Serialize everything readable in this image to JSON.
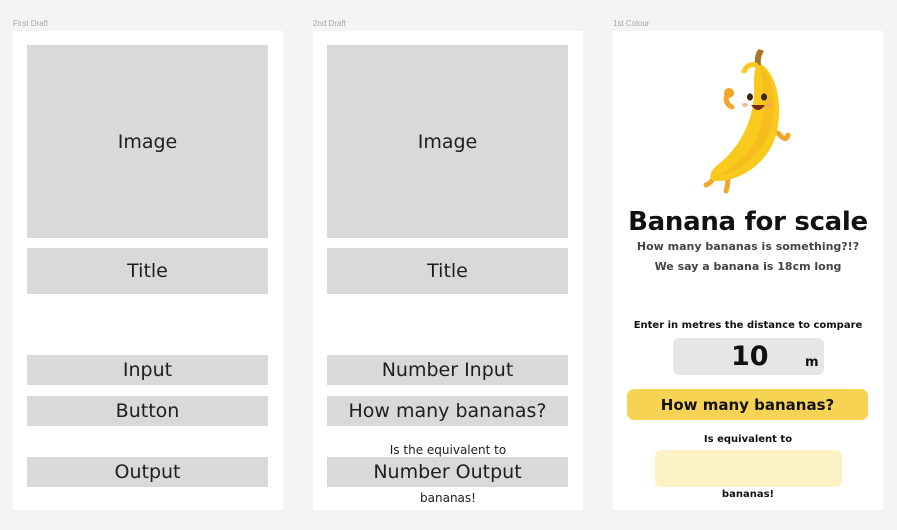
{
  "frames": {
    "first": {
      "label": "First Draft",
      "image": "Image",
      "title": "Title",
      "input": "Input",
      "button": "Button",
      "output": "Output"
    },
    "second": {
      "label": "2nd Draft",
      "image": "Image",
      "title": "Title",
      "input": "Number Input",
      "button": "How many bananas?",
      "equivalent": "Is the equivalent to",
      "output": "Number Output",
      "suffix": "bananas!"
    },
    "colour": {
      "label": "1st Colour",
      "title": "Banana for scale",
      "subtitle1": "How many bananas is something?!?",
      "subtitle2": "We say a banana is 18cm long",
      "input_label": "Enter in metres the distance to compare",
      "input_value": "10",
      "input_unit": "m",
      "button": "How many bananas?",
      "equivalent": "Is equivalent to",
      "output_value": "",
      "suffix": "bananas!",
      "colors": {
        "button": "#f7d354",
        "output": "#fdf2c5",
        "input": "#e6e6e6",
        "banana": "#f9c91b"
      },
      "illustration": "banana-mascot-icon"
    }
  }
}
